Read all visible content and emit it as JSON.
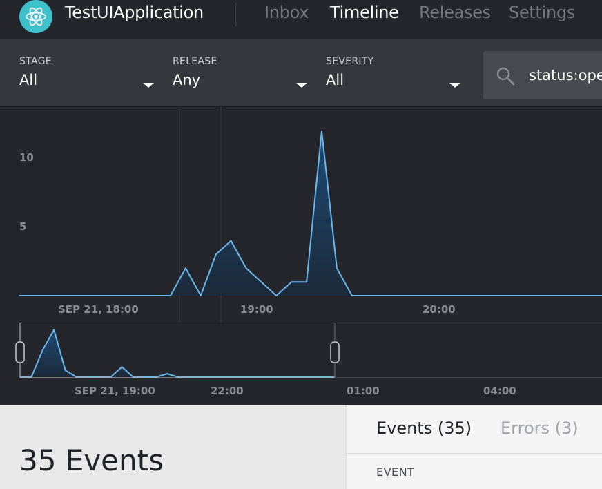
{
  "app": {
    "name": "TestUIApplication",
    "logo_icon": "react-atom-icon"
  },
  "nav": {
    "items": [
      {
        "label": "Inbox",
        "active": false
      },
      {
        "label": "Timeline",
        "active": true
      },
      {
        "label": "Releases",
        "active": false
      },
      {
        "label": "Settings",
        "active": false
      }
    ]
  },
  "filters": {
    "stage": {
      "label": "STAGE",
      "value": "All"
    },
    "release": {
      "label": "RELEASE",
      "value": "Any"
    },
    "severity": {
      "label": "SEVERITY",
      "value": "All"
    }
  },
  "search": {
    "value": "status:ope",
    "icon": "search-icon"
  },
  "colors": {
    "accent": "#6bb8ee",
    "logo": "#3fc1cc"
  },
  "chart_data": [
    {
      "type": "area",
      "x_ticks": [
        "SEP 21, 18:00",
        "19:00",
        "20:00"
      ],
      "y_ticks": [
        5,
        10
      ],
      "ylim": [
        0,
        12
      ],
      "values": [
        0,
        0,
        0,
        0,
        0,
        0,
        0,
        0,
        0,
        0,
        0,
        2,
        0,
        3,
        4,
        2,
        1,
        0,
        1,
        1,
        12,
        2,
        0,
        0,
        0,
        0,
        0,
        0,
        0,
        0,
        0,
        0,
        0,
        0,
        0,
        0,
        0,
        0,
        0,
        0
      ]
    },
    {
      "type": "area",
      "x_ticks": [
        "SEP 21, 19:00",
        "22:00",
        "01:00",
        "04:00"
      ],
      "values": [
        0,
        0,
        4,
        7,
        1,
        0,
        0,
        0,
        0,
        1.5,
        0,
        0,
        0,
        0.5,
        0,
        0,
        0,
        0,
        0,
        0,
        0,
        0,
        0,
        0,
        0,
        0
      ]
    }
  ],
  "bottom": {
    "heading": "35 Events",
    "tabs": [
      {
        "label": "Events (35)",
        "active": true
      },
      {
        "label": "Errors (3)",
        "active": false
      }
    ],
    "column_header": "EVENT"
  }
}
